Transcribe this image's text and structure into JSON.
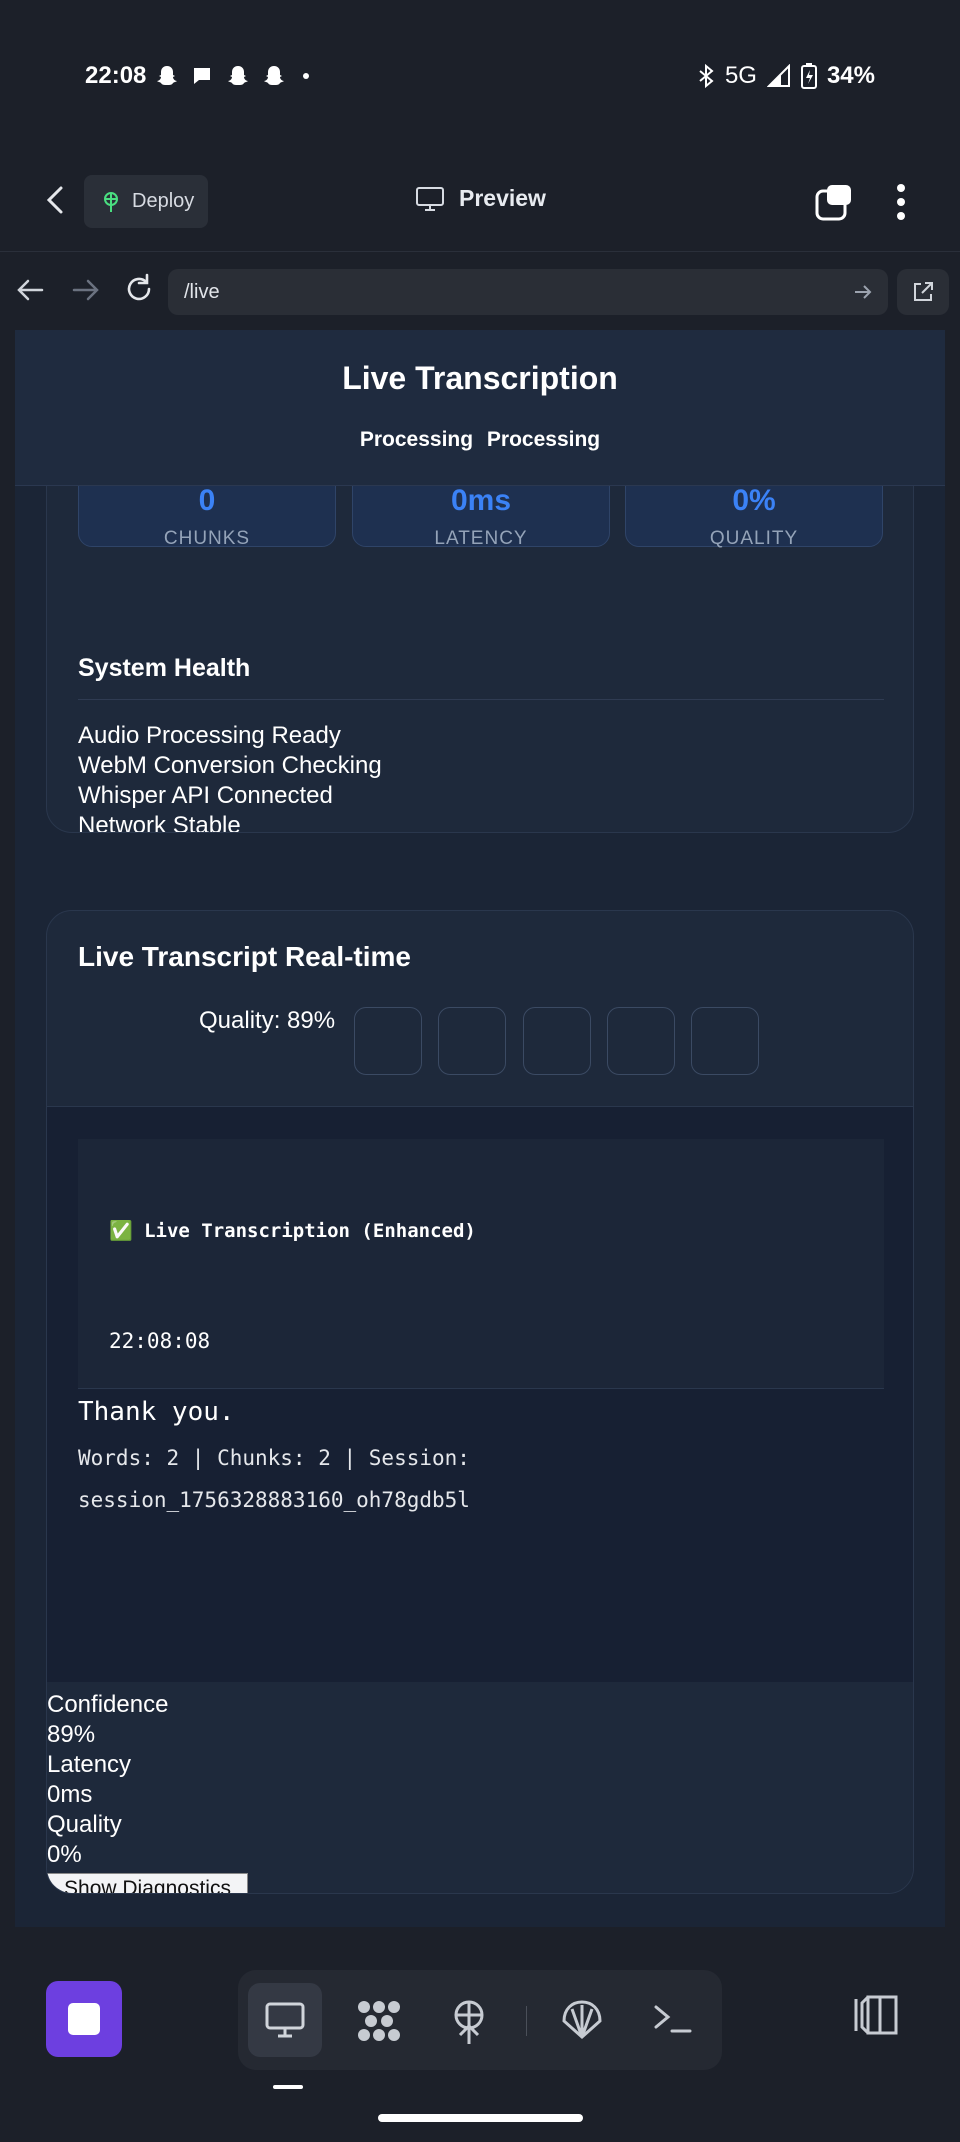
{
  "status_bar": {
    "time": "22:08",
    "network": "5G",
    "battery": "34%",
    "icons": [
      "snapchat-icon",
      "chat-icon",
      "snapchat-icon",
      "snapchat-icon",
      "dot-icon",
      "bluetooth-icon",
      "signal-icon",
      "battery-icon"
    ]
  },
  "app_header": {
    "deploy_label": "Deploy",
    "title": "Preview"
  },
  "url_bar": {
    "url": "/live"
  },
  "page": {
    "title": "Live Transcription",
    "status": [
      "Processing",
      "Processing"
    ],
    "metrics": [
      {
        "value": "0",
        "label": "CHUNKS"
      },
      {
        "value": "0ms",
        "label": "LATENCY"
      },
      {
        "value": "0%",
        "label": "QUALITY"
      }
    ],
    "system_health": {
      "title": "System Health",
      "items": [
        "Audio Processing Ready",
        "WebM Conversion Checking",
        "Whisper API Connected",
        "Network Stable"
      ]
    },
    "transcript": {
      "title": "Live Transcript Real-time",
      "quality_label": "Quality: 89%",
      "enhanced_label": "✅ Live Transcription (Enhanced)",
      "timestamp": "22:08:08",
      "text": "Thank you.",
      "meta_line1": "Words: 2 | Chunks: 2 | Session:",
      "meta_line2": "session_1756328883160_oh78gdb5l"
    },
    "stats": [
      {
        "label": "Confidence",
        "value": "89%"
      },
      {
        "label": "Latency",
        "value": "0ms"
      },
      {
        "label": "Quality",
        "value": "0%"
      }
    ],
    "diagnostics_button": "Show Diagnostics"
  },
  "colors": {
    "accent_blue": "#3b82f6",
    "stop_button": "#6d3fe0",
    "deploy_icon": "#4ade80"
  }
}
